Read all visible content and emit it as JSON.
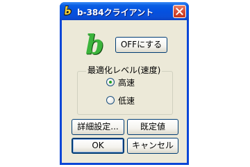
{
  "window": {
    "title": "b-384クライアント",
    "app_icon": "b-app-icon",
    "close_icon": "close-x-icon"
  },
  "logo": {
    "letter": "b",
    "color": "#3cb43c"
  },
  "off_button_label": "OFFにする",
  "optimization_group": {
    "label": "最適化レベル(速度)",
    "options": [
      {
        "label": "高速",
        "selected": true
      },
      {
        "label": "低速",
        "selected": false
      }
    ]
  },
  "buttons": {
    "details_label": "詳細設定...",
    "defaults_label": "既定値",
    "ok_label": "OK",
    "cancel_label": "キャンセル"
  },
  "colors": {
    "titlebar": "#0551e0",
    "window_bg": "#ece9d8",
    "close_button": "#d8503a",
    "radio_dot": "#21a121"
  }
}
